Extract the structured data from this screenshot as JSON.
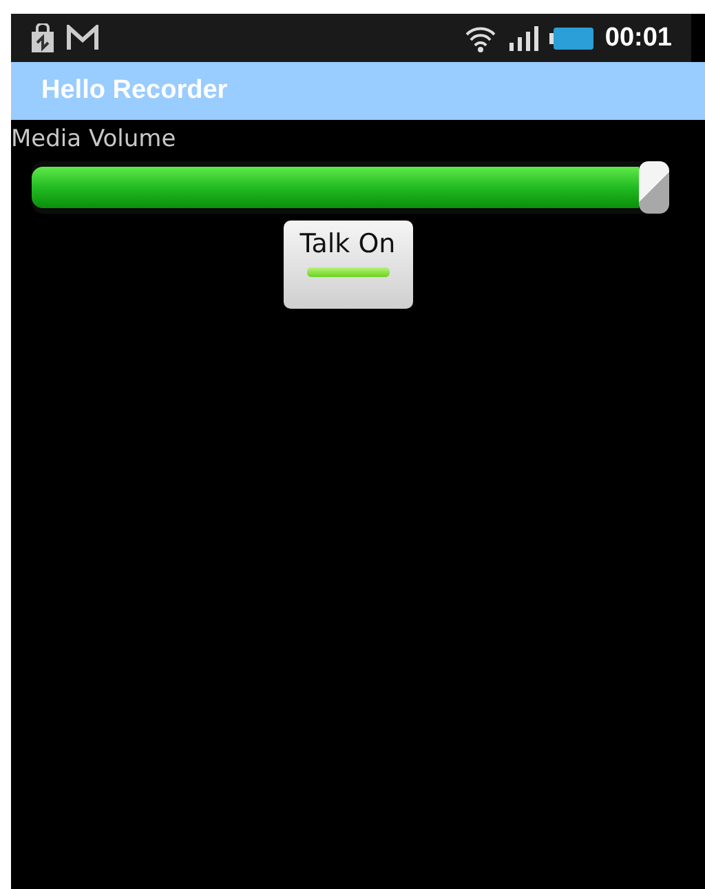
{
  "status_bar": {
    "time": "00:01"
  },
  "title_bar": {
    "title": "Hello Recorder"
  },
  "volume": {
    "label": "Media Volume",
    "level": 1.0
  },
  "toggle_button": {
    "label": "Talk On",
    "on": true
  }
}
